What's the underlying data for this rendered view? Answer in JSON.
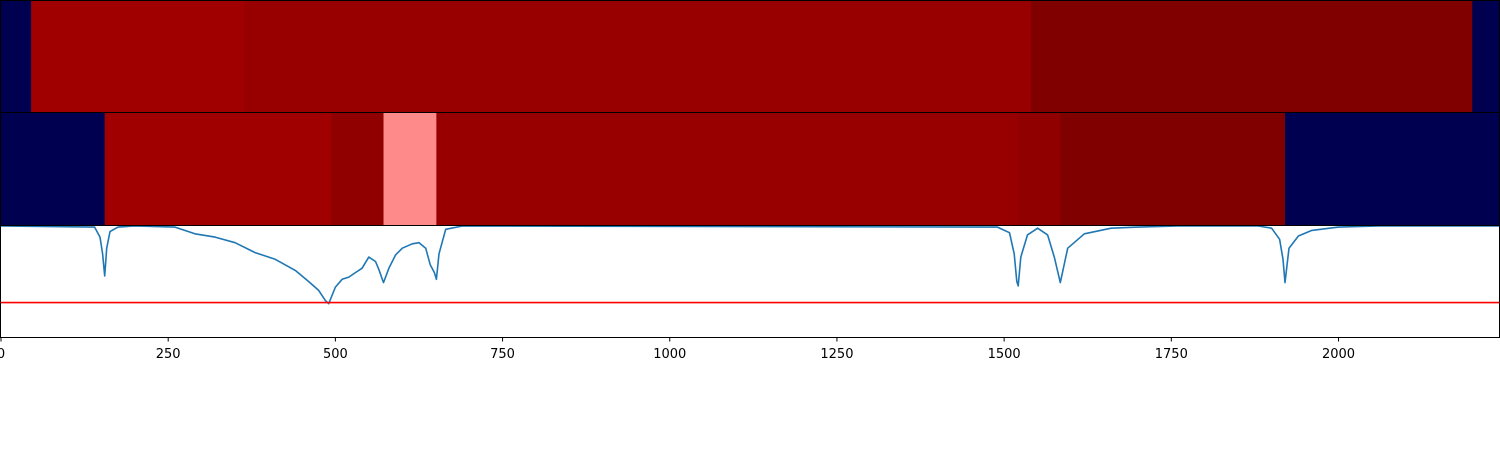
{
  "chart_data": [
    {
      "type": "heatmap",
      "xlim": [
        0,
        2240
      ],
      "segments": [
        {
          "start": 0,
          "end": 45,
          "color": "#000050"
        },
        {
          "start": 45,
          "end": 363,
          "color": "#a00000"
        },
        {
          "start": 363,
          "end": 1540,
          "color": "#980000"
        },
        {
          "start": 1540,
          "end": 2200,
          "color": "#800000"
        },
        {
          "start": 2200,
          "end": 2240,
          "color": "#000050"
        }
      ]
    },
    {
      "type": "heatmap",
      "xlim": [
        0,
        2240
      ],
      "segments": [
        {
          "start": 0,
          "end": 155,
          "color": "#000050"
        },
        {
          "start": 155,
          "end": 494,
          "color": "#a00000"
        },
        {
          "start": 494,
          "end": 572,
          "color": "#900000"
        },
        {
          "start": 572,
          "end": 651,
          "color": "#ff8a8a"
        },
        {
          "start": 651,
          "end": 1521,
          "color": "#980000"
        },
        {
          "start": 1521,
          "end": 1584,
          "color": "#900000"
        },
        {
          "start": 1584,
          "end": 1920,
          "color": "#800000"
        },
        {
          "start": 1920,
          "end": 2240,
          "color": "#000050"
        }
      ]
    },
    {
      "type": "line",
      "xlim": [
        0,
        2240
      ],
      "ylim": [
        0,
        1
      ],
      "series": [
        {
          "color": "#1f77b4",
          "x": [
            0,
            140,
            148,
            152,
            155,
            158,
            163,
            175,
            200,
            260,
            290,
            320,
            350,
            380,
            410,
            440,
            460,
            475,
            485,
            490,
            494,
            500,
            510,
            520,
            530,
            540,
            550,
            560,
            565,
            572,
            580,
            590,
            600,
            615,
            625,
            635,
            642,
            648,
            651,
            655,
            665,
            690,
            1490,
            1508,
            1515,
            1519,
            1521,
            1525,
            1535,
            1550,
            1565,
            1575,
            1584,
            1595,
            1620,
            1660,
            1700,
            1760,
            1880,
            1900,
            1912,
            1917,
            1920,
            1926,
            1940,
            1960,
            2000,
            2060,
            2240
          ],
          "y": [
            1.0,
            0.99,
            0.9,
            0.75,
            0.55,
            0.8,
            0.95,
            0.99,
            1.0,
            0.99,
            0.93,
            0.9,
            0.85,
            0.76,
            0.7,
            0.6,
            0.5,
            0.42,
            0.33,
            0.3,
            0.36,
            0.45,
            0.52,
            0.54,
            0.58,
            0.62,
            0.72,
            0.68,
            0.61,
            0.49,
            0.62,
            0.74,
            0.8,
            0.84,
            0.85,
            0.8,
            0.65,
            0.58,
            0.52,
            0.75,
            0.97,
            1.0,
            0.99,
            0.94,
            0.75,
            0.5,
            0.46,
            0.72,
            0.92,
            0.98,
            0.92,
            0.72,
            0.49,
            0.8,
            0.93,
            0.98,
            0.99,
            1.0,
            1.0,
            0.98,
            0.88,
            0.7,
            0.49,
            0.8,
            0.91,
            0.96,
            0.99,
            1.0,
            1.0
          ]
        },
        {
          "color": "#ff0000",
          "x": [
            0,
            2240
          ],
          "y": [
            0.31,
            0.31
          ]
        }
      ],
      "xticks": [
        "0",
        "250",
        "500",
        "750",
        "1000",
        "1250",
        "1500",
        "1750",
        "2000"
      ]
    }
  ]
}
